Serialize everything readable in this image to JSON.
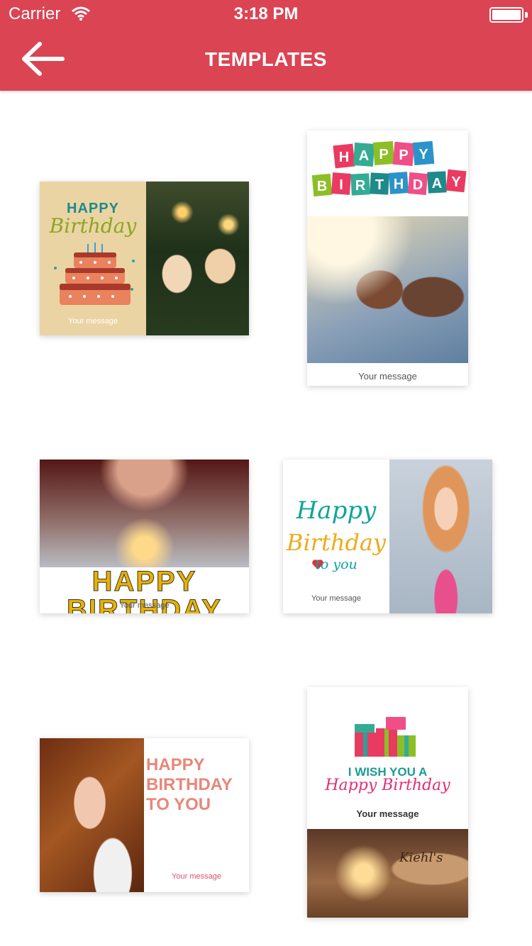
{
  "status_bar": {
    "carrier": "Carrier",
    "time": "3:18 PM",
    "icons": [
      "wifi-icon",
      "battery-icon"
    ]
  },
  "nav": {
    "title": "TEMPLATES",
    "back_icon": "arrow-left-icon"
  },
  "colors": {
    "accent": "#db4453",
    "background": "#ffffff"
  },
  "templates": [
    {
      "happy": "HAPPY",
      "birthday": "Birthday",
      "message": "Your message"
    },
    {
      "letters_top": [
        "H",
        "A",
        "P",
        "P",
        "Y"
      ],
      "letters_bottom": [
        "B",
        "I",
        "R",
        "T",
        "H",
        "D",
        "A",
        "Y"
      ],
      "message": "Your message"
    },
    {
      "headline": "HAPPY BIRTHDAY",
      "message": "Your message"
    },
    {
      "happy": "Happy",
      "birthday": "Birthday",
      "to_you": "to you",
      "message": "Your message"
    },
    {
      "line1": "HAPPY",
      "line2": "BIRTHDAY",
      "line3": "TO YOU",
      "message": "Your message"
    },
    {
      "wish": "I WISH YOU A",
      "happy_birthday": "Happy Birthday",
      "message": "Your message",
      "photo_brand": "Kiehl's"
    }
  ]
}
